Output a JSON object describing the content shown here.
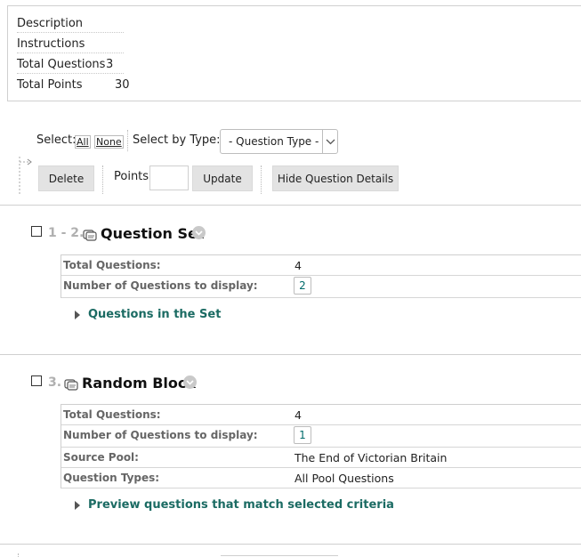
{
  "summary": {
    "rows": [
      {
        "label": "Description",
        "value": ""
      },
      {
        "label": "Instructions",
        "value": ""
      },
      {
        "label": "Total Questions",
        "value": "3"
      },
      {
        "label": "Total Points",
        "value": "30"
      }
    ]
  },
  "toolbar": {
    "select_label": "Select:",
    "select_all": "All",
    "select_none": "None",
    "select_by_type_label": "Select by Type:",
    "question_type_value": "- Question Type -",
    "delete_label": "Delete",
    "points_label": "Points",
    "points_value": "",
    "update_label": "Update",
    "hide_details_label": "Hide Question Details"
  },
  "items": [
    {
      "number": "1 - 2.",
      "title": "Question Set",
      "details": [
        {
          "label": "Total Questions:",
          "value": "4"
        },
        {
          "label": "Number of Questions to display:",
          "value": "2"
        }
      ],
      "expander": "Questions in the Set"
    },
    {
      "number": "3.",
      "title": "Random Block",
      "details": [
        {
          "label": "Total Questions:",
          "value": "4"
        },
        {
          "label": "Number of Questions to display:",
          "value": "1"
        },
        {
          "label": "Source Pool:",
          "value": "The End of Victorian Britain"
        },
        {
          "label": "Question Types:",
          "value": "All Pool Questions"
        }
      ],
      "expander": "Preview questions that match selected criteria"
    }
  ],
  "colors": {
    "link_teal": "#1b6b63",
    "button_gray": "#e3e3e3"
  }
}
